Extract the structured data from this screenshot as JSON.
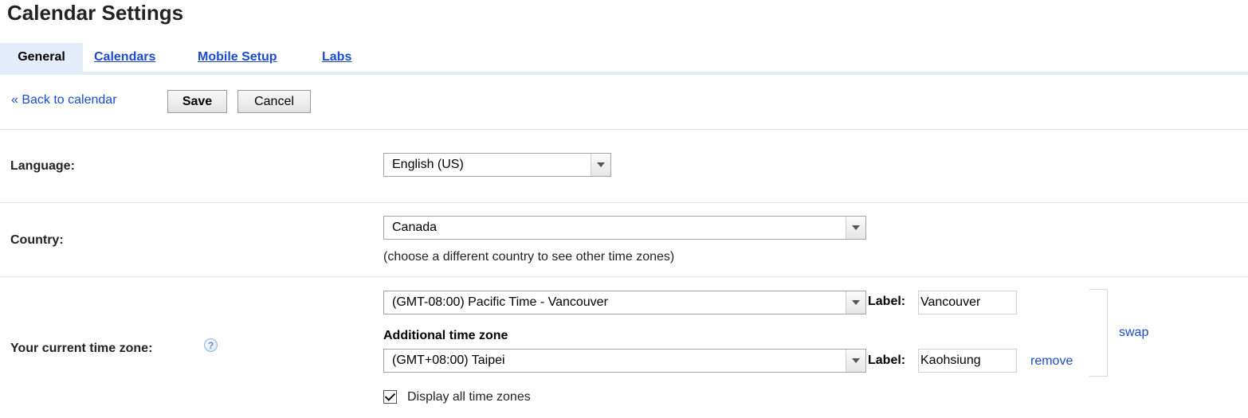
{
  "page": {
    "title": "Calendar Settings"
  },
  "tabs": [
    {
      "label": "General",
      "active": true
    },
    {
      "label": "Calendars",
      "active": false
    },
    {
      "label": "Mobile Setup",
      "active": false
    },
    {
      "label": "Labs",
      "active": false
    }
  ],
  "toolbar": {
    "back_label": "« Back to calendar",
    "save_label": "Save",
    "cancel_label": "Cancel"
  },
  "language": {
    "label": "Language:",
    "selected": "English (US)"
  },
  "country": {
    "label": "Country:",
    "selected": "Canada",
    "hint": "(choose a different country to see other time zones)"
  },
  "timezone": {
    "label": "Your current time zone:",
    "help_icon": "help-icon",
    "primary": {
      "selected": "(GMT-08:00) Pacific Time - Vancouver",
      "label_caption": "Label:",
      "label_value": "Vancouver"
    },
    "additional_heading": "Additional time zone",
    "secondary": {
      "selected": "(GMT+08:00) Taipei",
      "label_caption": "Label:",
      "label_value": "Kaohsiung",
      "remove_label": "remove"
    },
    "swap_label": "swap",
    "display_all": {
      "label": "Display all time zones",
      "checked": true
    }
  },
  "colors": {
    "link": "#1a4bd1",
    "tab_bg": "#e5ecf9",
    "divider": "#e5e5e5"
  }
}
